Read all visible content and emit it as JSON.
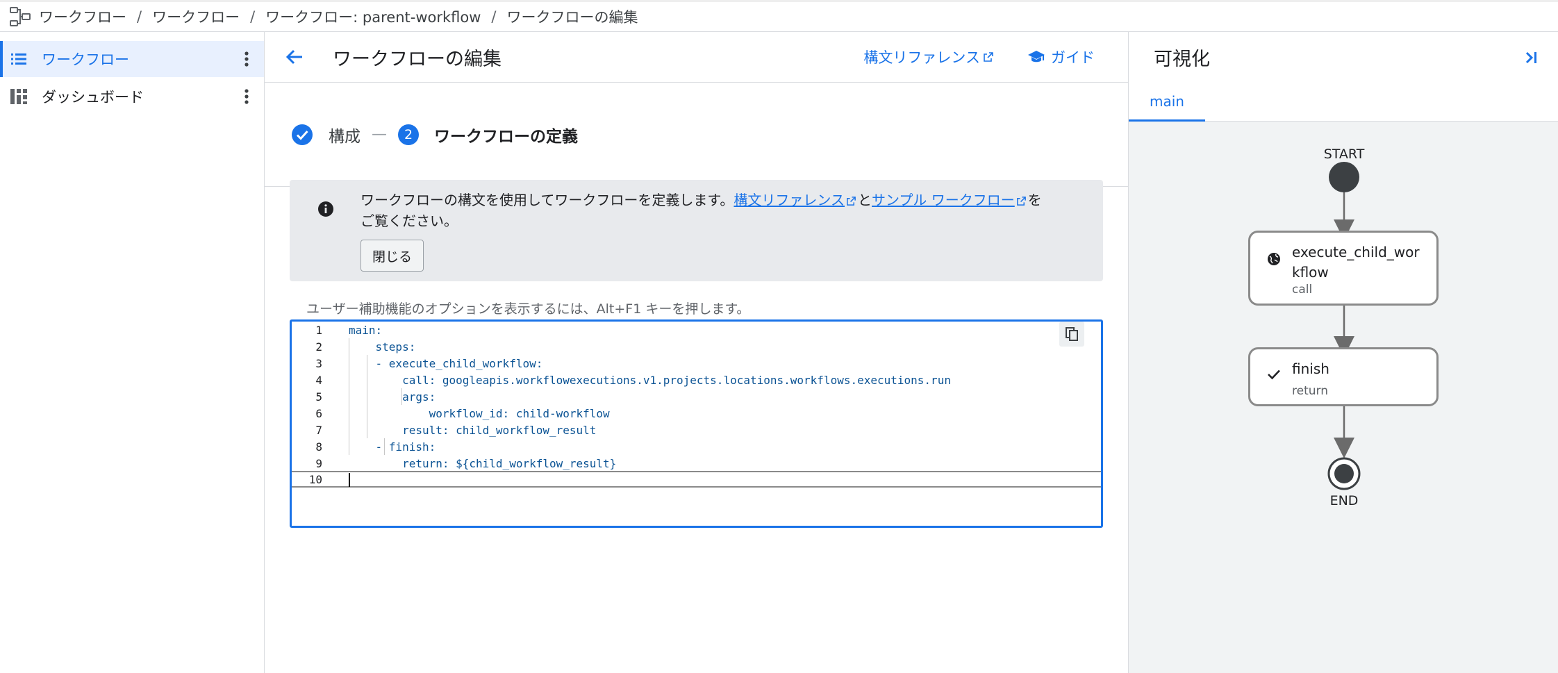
{
  "breadcrumb": {
    "items": [
      "ワークフロー",
      "ワークフロー",
      "ワークフロー: parent-workflow",
      "ワークフローの編集"
    ],
    "separator": "/"
  },
  "sidebar": {
    "items": [
      {
        "label": "ワークフロー",
        "icon": "list-icon",
        "active": true
      },
      {
        "label": "ダッシュボード",
        "icon": "dashboard-icon",
        "active": false
      }
    ]
  },
  "main": {
    "title": "ワークフローの編集",
    "syntax_reference_link": "構文リファレンス",
    "guide_link": "ガイド",
    "stepper": {
      "step1_label": "構成",
      "step_separator": "—",
      "step2_number": "2",
      "step2_label": "ワークフローの定義"
    },
    "info": {
      "text_before": "ワークフローの構文を使用してワークフローを定義します。",
      "link1": "構文リファレンス",
      "text_mid": "と",
      "link2": "サンプル ワークフロー",
      "text_after": "を",
      "text_line2": "ご覧ください。",
      "close_button": "閉じる"
    },
    "accessibility_hint": "ユーザー補助機能のオプションを表示するには、Alt+F1 キーを押します。",
    "editor": {
      "lines": [
        {
          "num": "1",
          "text": "main:"
        },
        {
          "num": "2",
          "text": "    steps:"
        },
        {
          "num": "3",
          "text": "    - execute_child_workflow:"
        },
        {
          "num": "4",
          "text": "        call: googleapis.workflowexecutions.v1.projects.locations.workflows.executions.run"
        },
        {
          "num": "5",
          "text": "        args:"
        },
        {
          "num": "6",
          "text": "            workflow_id: child-workflow"
        },
        {
          "num": "7",
          "text": "        result: child_workflow_result"
        },
        {
          "num": "8",
          "text": "    - finish:"
        },
        {
          "num": "9",
          "text": "        return: ${child_workflow_result}"
        },
        {
          "num": "10",
          "text": ""
        }
      ]
    }
  },
  "visualization": {
    "title": "可視化",
    "tab": "main",
    "start_label": "START",
    "end_label": "END",
    "nodes": [
      {
        "name": "execute_child_wor\nkflow",
        "name_line1": "execute_child_wor",
        "name_line2": "kflow",
        "type": "call",
        "icon": "globe-icon"
      },
      {
        "name": "finish",
        "type": "return",
        "icon": "check-icon"
      }
    ]
  },
  "colors": {
    "accent": "#1a73e8",
    "node_border": "#8a8a8a",
    "canvas_bg": "#f1f3f4",
    "start_end": "#3c4043"
  }
}
